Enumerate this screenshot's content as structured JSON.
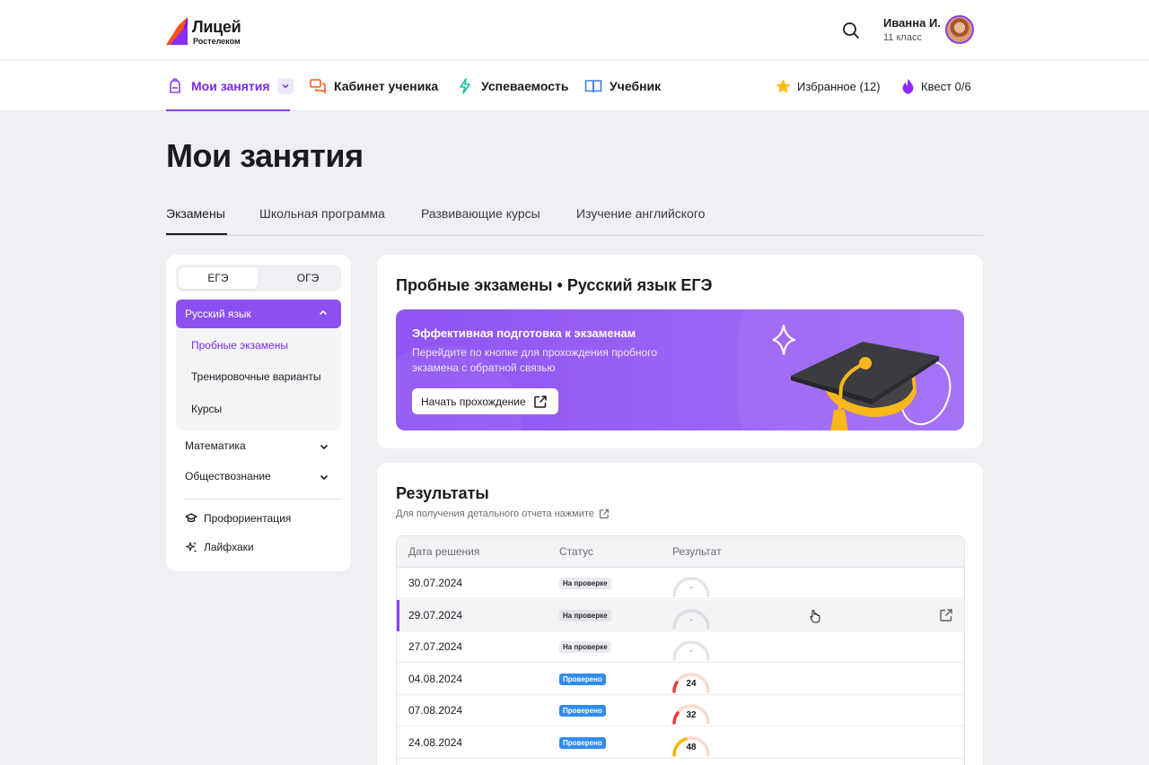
{
  "brand": {
    "title": "Лицей",
    "subtitle": "Ростелеком",
    "colors": {
      "accent": "#8a3ff2",
      "logo_red": "#ff4f12",
      "logo_purple": "#7700ff"
    }
  },
  "header": {
    "search_icon": "search-icon",
    "user_name": "Иванна И.",
    "user_class": "11 класс"
  },
  "nav": {
    "items": [
      {
        "label": "Мои занятия",
        "icon": "backpack-icon",
        "active": true
      },
      {
        "label": "Кабинет ученика",
        "icon": "chat-icon"
      },
      {
        "label": "Успеваемость",
        "icon": "lightning-icon"
      },
      {
        "label": "Учебник",
        "icon": "book-icon"
      }
    ],
    "favorites": "Избранное (12)",
    "quest": "Квест 0/6"
  },
  "page_title": "Мои занятия",
  "tabs": [
    "Экзамены",
    "Школьная программа",
    "Развивающие курсы",
    "Изучение английского"
  ],
  "sidebar": {
    "segments": [
      "ЕГЭ",
      "ОГЭ"
    ],
    "open_subject": "Русский язык",
    "sub_items": [
      "Пробные экзамены",
      "Тренировочные варианты",
      "Курсы"
    ],
    "subjects": [
      "Математика",
      "Обществознание"
    ],
    "links": [
      "Профориентация",
      "Лайфхаки"
    ]
  },
  "exam_card": {
    "title": "Пробные экзамены • Русский язык ЕГЭ",
    "banner_title": "Эффективная подготовка к экзаменам",
    "banner_text": "Перейдите по кнопке для прохождения пробного экзамена с обратной связью",
    "button": "Начать прохождение"
  },
  "results": {
    "title": "Результаты",
    "subtitle": "Для получения детального отчета нажмите",
    "columns": [
      "Дата решения",
      "Статус",
      "Результат"
    ],
    "rows": [
      {
        "date": "30.07.2024",
        "status": "На проверке",
        "result": "-"
      },
      {
        "date": "29.07.2024",
        "status": "На проверке",
        "result": "-"
      },
      {
        "date": "27.07.2024",
        "status": "На проверке",
        "result": "-"
      },
      {
        "date": "04.08.2024",
        "status": "Проверено",
        "result": "24"
      },
      {
        "date": "07.08.2024",
        "status": "Проверено",
        "result": "32"
      },
      {
        "date": "24.08.2024",
        "status": "Проверено",
        "result": "48"
      }
    ]
  }
}
